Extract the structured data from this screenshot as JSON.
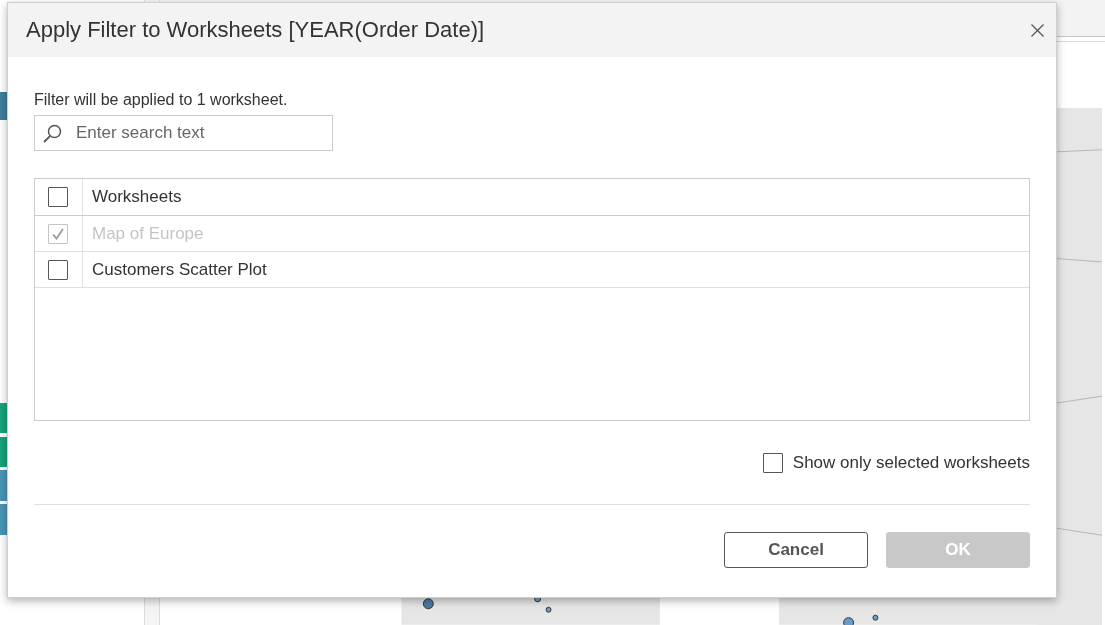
{
  "dialog": {
    "title": "Apply Filter to Worksheets [YEAR(Order Date)]",
    "message": "Filter will be applied to 1 worksheet.",
    "search": {
      "placeholder": "Enter search text"
    },
    "list": {
      "header": {
        "label": "Worksheets",
        "checked": false
      },
      "rows": [
        {
          "label": "Map of Europe",
          "checked": true,
          "disabled": true
        },
        {
          "label": "Customers Scatter Plot",
          "checked": false,
          "disabled": false
        }
      ]
    },
    "show_only_selected": {
      "label": "Show only selected worksheets",
      "checked": false
    },
    "buttons": [
      {
        "label": "Cancel",
        "kind": "secondary",
        "disabled": false
      },
      {
        "label": "OK",
        "kind": "primary",
        "disabled": true
      }
    ]
  }
}
